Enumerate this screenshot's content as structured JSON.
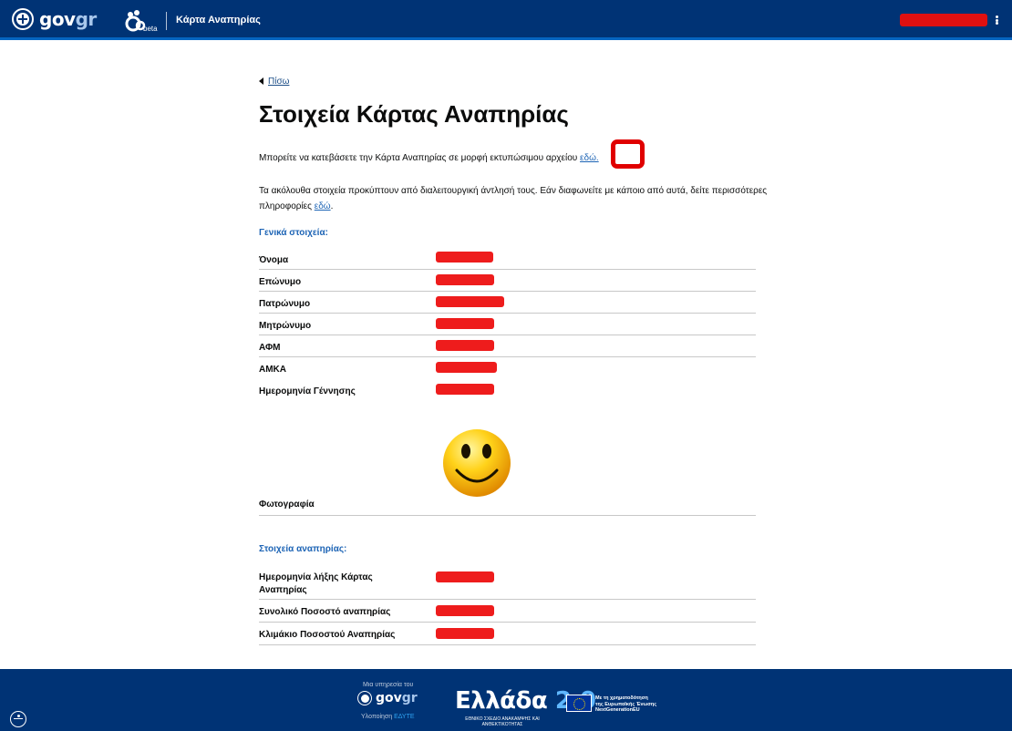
{
  "header": {
    "logo_text_gov": "gov",
    "logo_text_gr": "gr",
    "beta": "beta",
    "app_title": "Κάρτα Αναπηρίας"
  },
  "main": {
    "back_label": "Πίσω",
    "title": "Στοιχεία Κάρτας Αναπηρίας",
    "download_text": "Μπορείτε να κατεβάσετε την Κάρτα Αναπηρίας σε μορφή εκτυπώσιμου αρχείου ",
    "download_link": "εδώ.",
    "info_text": "Τα ακόλουθα στοιχεία προκύπτουν από διαλειτουργική άντλησή τους. Εάν διαφωνείτε με κάποιο από αυτά, δείτε περισσότερες πληροφορίες ",
    "info_link": "εδώ",
    "info_tail": ".",
    "general_title": "Γενικά στοιχεία:",
    "general_rows": [
      {
        "label": "Όνομα"
      },
      {
        "label": "Επώνυμο"
      },
      {
        "label": "Πατρώνυμο"
      },
      {
        "label": "Μητρώνυμο"
      },
      {
        "label": "ΑΦΜ"
      },
      {
        "label": "ΑΜΚΑ"
      },
      {
        "label": "Ημερομηνία Γέννησης"
      }
    ],
    "photo_label": "Φωτογραφία",
    "disability_title": "Στοιχεία αναπηρίας:",
    "disability_rows": [
      {
        "label": "Ημερομηνία λήξης Κάρτας Αναπηρίας"
      },
      {
        "label": "Συνολικό Ποσοστό αναπηρίας"
      },
      {
        "label": "Κλιμάκιο Ποσοστού Αναπηρίας"
      }
    ]
  },
  "footer": {
    "service_of": "Μια υπηρεσία του",
    "gov": "gov",
    "gr": "gr",
    "implementation": "Υλοποίηση ",
    "implementer": "ΕΔΥΤΕ",
    "ellada": "Ελλάδα ",
    "ellada_version": "2.0",
    "ellada_sub": "ΕΘΝΙΚΟ ΣΧΕΔΙΟ ΑΝΑΚΑΜΨΗΣ ΚΑΙ ΑΝΘΕΚΤΙΚΟΤΗΤΑΣ",
    "eu_line1": "Με τη χρηματοδότηση",
    "eu_line2": "της Ευρωπαϊκής Ένωσης",
    "eu_line3": "NextGenerationEU"
  },
  "colors": {
    "header_bg": "#003375",
    "link": "#1d64b5",
    "redaction": "#ee1c1c",
    "highlight": "#e00000"
  }
}
